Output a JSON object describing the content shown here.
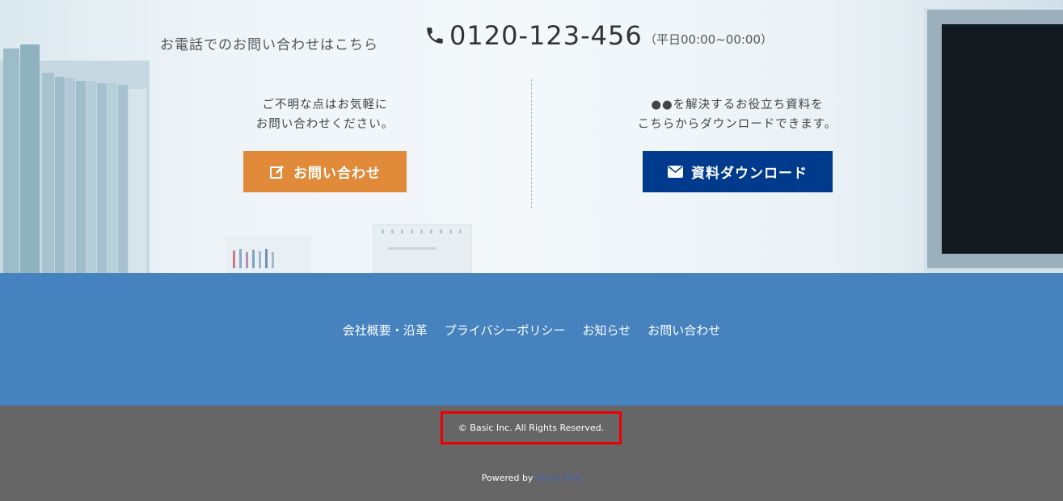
{
  "contact_section": {
    "phone_caption": "お電話でのお問い合わせはこちら",
    "phone_number": "0120-123-456",
    "phone_hours": "（平日00:00~00:00）",
    "phone_icon": "phone-icon",
    "left_column": {
      "line1": "ご不明な点はお気軽に",
      "line2": "お問い合わせください。",
      "button_label": "お問い合わせ",
      "button_icon": "edit-icon",
      "button_color": "#e08a3a"
    },
    "right_column": {
      "line1": "●●を解決するお役立ち資料を",
      "line2": "こちらからダウンロードできます。",
      "button_label": "資料ダウンロード",
      "button_icon": "envelope-icon",
      "button_color": "#003a8c"
    }
  },
  "footer_nav": {
    "background": "#4582be",
    "links": [
      "会社概要・沿革",
      "プライバシーポリシー",
      "お知らせ",
      "お問い合わせ"
    ]
  },
  "footer_bottom": {
    "background": "#666666",
    "copyright": "© Basic Inc. All Rights Reserved.",
    "highlight_color": "#ee0000",
    "powered_prefix": "Powered by",
    "powered_link": "ferret One"
  }
}
